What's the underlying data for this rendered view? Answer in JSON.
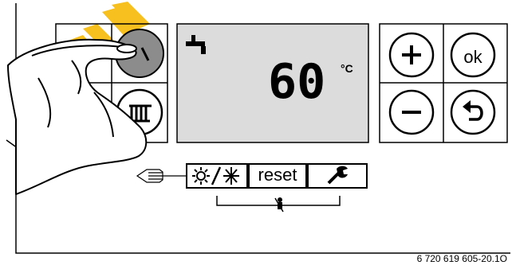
{
  "display": {
    "temperature_value": "60",
    "temperature_unit": "°C",
    "mode_icon": "tap-hot-water-icon"
  },
  "buttons": {
    "plus_icon": "plus-icon",
    "ok_label": "ok",
    "minus_icon": "minus-icon",
    "back_icon": "back-arrow-icon",
    "dial_icon": "dial-icon",
    "heating_icon": "radiator-icon",
    "summer_winter_icon": "sun-snowflake-icon",
    "reset_label": "reset",
    "service_icon": "wrench-icon",
    "chimney_sweep_icon": "chimney-sweep-icon",
    "pointer_icon": "pointing-hand-icon"
  },
  "figure": {
    "code": "6 720 619 605-20.1O"
  },
  "colors": {
    "watermark": "#f7c01f",
    "lcd_background": "#dcdcdc",
    "dial_fill": "#8c8c8c"
  }
}
